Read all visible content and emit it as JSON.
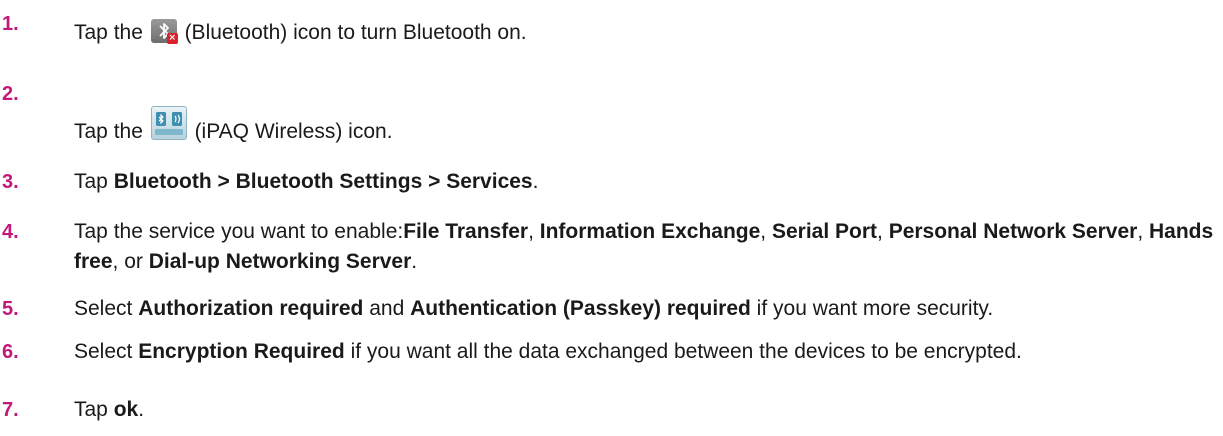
{
  "steps": [
    {
      "number": "1.",
      "parts": [
        {
          "t": "Tap the "
        },
        {
          "icon": "bluetooth-icon"
        },
        {
          "t": " (Bluetooth) icon to turn Bluetooth on."
        }
      ]
    },
    {
      "number": "2.",
      "parts": [
        {
          "t": "Tap the "
        },
        {
          "icon": "ipaq-wireless-icon"
        },
        {
          "t": " (iPAQ Wireless) icon."
        }
      ]
    },
    {
      "number": "3.",
      "parts": [
        {
          "t": "Tap "
        },
        {
          "b": "Bluetooth > Bluetooth Settings > Services"
        },
        {
          "t": "."
        }
      ]
    },
    {
      "number": "4.",
      "parts": [
        {
          "t": "Tap the service you want to enable:"
        },
        {
          "b": "File Transfer"
        },
        {
          "t": ", "
        },
        {
          "b": "Information Exchange"
        },
        {
          "t": ", "
        },
        {
          "b": "Serial Port"
        },
        {
          "t": ", "
        },
        {
          "b": "Personal Network Server"
        },
        {
          "t": ", "
        },
        {
          "b": "Hands free"
        },
        {
          "t": ", or "
        },
        {
          "b": "Dial-up Networking Server"
        },
        {
          "t": "."
        }
      ]
    },
    {
      "number": "5.",
      "parts": [
        {
          "t": "Select "
        },
        {
          "b": "Authorization required"
        },
        {
          "t": " and "
        },
        {
          "b": "Authentication (Passkey) required"
        },
        {
          "t": " if you want more security."
        }
      ]
    },
    {
      "number": "6.",
      "parts": [
        {
          "t": "Select "
        },
        {
          "b": "Encryption Required"
        },
        {
          "t": " if you want all the data exchanged between the devices to be encrypted."
        }
      ]
    },
    {
      "number": "7.",
      "parts": [
        {
          "t": "Tap "
        },
        {
          "b": "ok"
        },
        {
          "t": "."
        }
      ]
    }
  ],
  "colors": {
    "step_number": "#c2187a",
    "text": "#1a1a1a"
  }
}
